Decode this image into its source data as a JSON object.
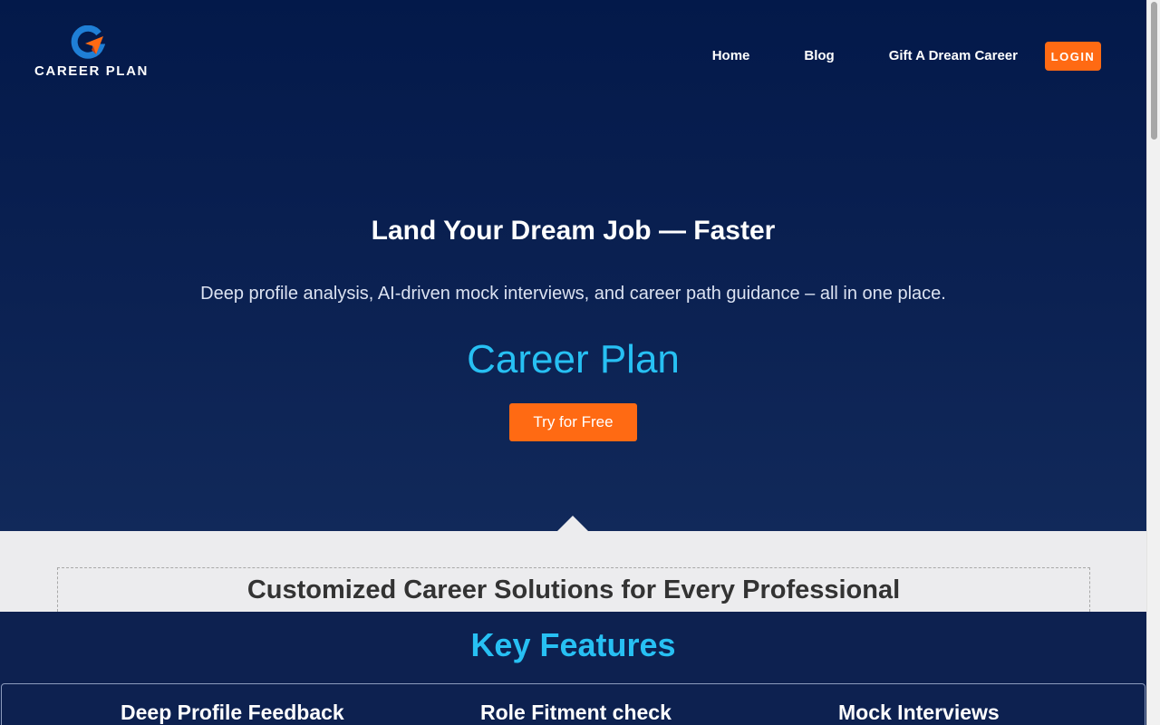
{
  "brand": {
    "name": "CAREER PLAN",
    "colors": {
      "primary_blue": "#0b2152",
      "accent_orange": "#ff6a13",
      "accent_cyan": "#27c0f3"
    }
  },
  "nav": {
    "items": [
      {
        "label": "Home"
      },
      {
        "label": "Blog"
      },
      {
        "label": "Gift A Dream Career"
      }
    ],
    "login_label": "LOGIN"
  },
  "hero": {
    "title": "Land Your Dream Job — Faster",
    "subtitle": "Deep profile analysis, AI-driven mock interviews, and career path guidance – all in one place.",
    "brand_text": "Career Plan",
    "cta_label": "Try for Free"
  },
  "solutions": {
    "title": "Customized Career Solutions for Every Professional"
  },
  "features": {
    "title": "Key Features",
    "items": [
      {
        "label": "Deep Profile Feedback"
      },
      {
        "label": "Role Fitment check"
      },
      {
        "label": "Mock Interviews"
      }
    ]
  }
}
